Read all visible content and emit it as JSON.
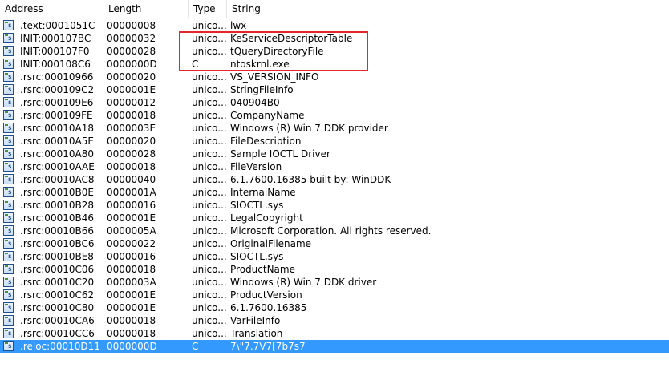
{
  "columns": {
    "address": "Address",
    "length": "Length",
    "type": "Type",
    "string": "String"
  },
  "icon_glyph": "'s'",
  "colors": {
    "selection": "#3399ff",
    "highlight_box": "#e4262c"
  },
  "rows": [
    {
      "address": ".text:0001051C",
      "length": "00000008",
      "type": "unico...",
      "string": "lwx"
    },
    {
      "address": "INIT:000107BC",
      "length": "00000032",
      "type": "unico...",
      "string": "KeServiceDescriptorTable"
    },
    {
      "address": "INIT:000107F0",
      "length": "00000028",
      "type": "unico...",
      "string": "tQueryDirectoryFile"
    },
    {
      "address": "INIT:000108C6",
      "length": "0000000D",
      "type": "C",
      "string": "ntoskrnl.exe"
    },
    {
      "address": ".rsrc:00010966",
      "length": "00000020",
      "type": "unico...",
      "string": "VS_VERSION_INFO"
    },
    {
      "address": ".rsrc:000109C2",
      "length": "0000001E",
      "type": "unico...",
      "string": "StringFileInfo"
    },
    {
      "address": ".rsrc:000109E6",
      "length": "00000012",
      "type": "unico...",
      "string": "040904B0"
    },
    {
      "address": ".rsrc:000109FE",
      "length": "00000018",
      "type": "unico...",
      "string": "CompanyName"
    },
    {
      "address": ".rsrc:00010A18",
      "length": "0000003E",
      "type": "unico...",
      "string": "Windows (R) Win 7 DDK provider"
    },
    {
      "address": ".rsrc:00010A5E",
      "length": "00000020",
      "type": "unico...",
      "string": "FileDescription"
    },
    {
      "address": ".rsrc:00010A80",
      "length": "00000028",
      "type": "unico...",
      "string": "Sample IOCTL Driver"
    },
    {
      "address": ".rsrc:00010AAE",
      "length": "00000018",
      "type": "unico...",
      "string": "FileVersion"
    },
    {
      "address": ".rsrc:00010AC8",
      "length": "00000040",
      "type": "unico...",
      "string": "6.1.7600.16385 built by: WinDDK"
    },
    {
      "address": ".rsrc:00010B0E",
      "length": "0000001A",
      "type": "unico...",
      "string": "InternalName"
    },
    {
      "address": ".rsrc:00010B28",
      "length": "00000016",
      "type": "unico...",
      "string": "SIOCTL.sys"
    },
    {
      "address": ".rsrc:00010B46",
      "length": "0000001E",
      "type": "unico...",
      "string": "LegalCopyright"
    },
    {
      "address": ".rsrc:00010B66",
      "length": "0000005A",
      "type": "unico...",
      "string": " Microsoft Corporation. All rights reserved."
    },
    {
      "address": ".rsrc:00010BC6",
      "length": "00000022",
      "type": "unico...",
      "string": "OriginalFilename"
    },
    {
      "address": ".rsrc:00010BE8",
      "length": "00000016",
      "type": "unico...",
      "string": "SIOCTL.sys"
    },
    {
      "address": ".rsrc:00010C06",
      "length": "00000018",
      "type": "unico...",
      "string": "ProductName"
    },
    {
      "address": ".rsrc:00010C20",
      "length": "0000003A",
      "type": "unico...",
      "string": "Windows (R) Win 7 DDK driver"
    },
    {
      "address": ".rsrc:00010C62",
      "length": "0000001E",
      "type": "unico...",
      "string": "ProductVersion"
    },
    {
      "address": ".rsrc:00010C80",
      "length": "0000001E",
      "type": "unico...",
      "string": "6.1.7600.16385"
    },
    {
      "address": ".rsrc:00010CA6",
      "length": "00000018",
      "type": "unico...",
      "string": "VarFileInfo"
    },
    {
      "address": ".rsrc:00010CC6",
      "length": "00000018",
      "type": "unico...",
      "string": "Translation"
    },
    {
      "address": ".reloc:00010D11",
      "length": "0000000D",
      "type": "C",
      "string": "7\\\"7.7V7[7b7s7",
      "selected": true
    }
  ]
}
